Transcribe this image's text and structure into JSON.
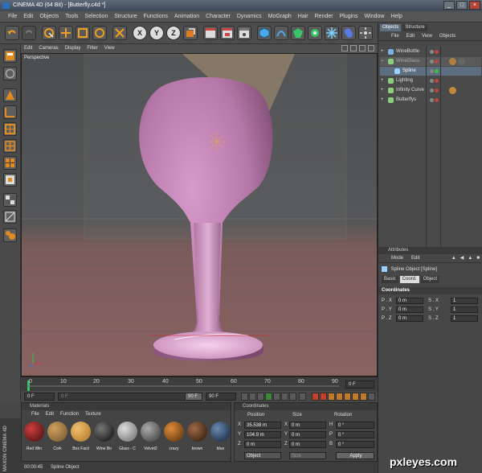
{
  "window": {
    "title": "CINEMA 4D (64 Bit) - [Butterfly.c4d *]",
    "buttons": [
      "_",
      "□",
      "×"
    ]
  },
  "menubar": [
    "File",
    "Edit",
    "Objects",
    "Tools",
    "Selection",
    "Structure",
    "Functions",
    "Animation",
    "Character",
    "Dynamics",
    "MoGraph",
    "Hair",
    "Render",
    "Plugins",
    "Window",
    "Help"
  ],
  "toolbar": {
    "axis_buttons": [
      "X",
      "Y",
      "Z"
    ]
  },
  "viewport": {
    "menu": [
      "Edit",
      "Cameras",
      "Display",
      "Filter",
      "View"
    ],
    "label": "Perspective"
  },
  "timeline": {
    "ticks": [
      "0",
      "10",
      "20",
      "30",
      "40",
      "50",
      "60",
      "70",
      "80",
      "90"
    ],
    "end_label": "0 F",
    "start_field": "0 F",
    "range_start": "0 F",
    "range_end": "90 F",
    "current": "90 F"
  },
  "materials": {
    "header": "Materials",
    "menu": [
      "File",
      "Edit",
      "Function",
      "Texture"
    ],
    "items": [
      {
        "name": "Red Win",
        "color": "#6b1a1a"
      },
      {
        "name": "Cork",
        "color": "#8a6a3a"
      },
      {
        "name": "Box Facil",
        "color": "#c08a3a"
      },
      {
        "name": "Wine Bo",
        "color": "#2a2a2a"
      },
      {
        "name": "Glass - C",
        "color": "#8a8a8a"
      },
      {
        "name": "Velvet2",
        "color": "#5a5a5a"
      },
      {
        "name": "crazy",
        "color": "#7a4a1a"
      },
      {
        "name": "brown",
        "color": "#4a2e1a"
      },
      {
        "name": "blue",
        "color": "#2a3e5a"
      }
    ]
  },
  "coordinates": {
    "header": "Coordinates",
    "columns": [
      "Position",
      "Size",
      "Rotation"
    ],
    "rows": [
      {
        "axis": "X",
        "pos": "35.538 m",
        "size_axis": "X",
        "size": "0 m",
        "rot_axis": "H",
        "rot": "0 °"
      },
      {
        "axis": "Y",
        "pos": "104.9 m",
        "size_axis": "Y",
        "size": "0 m",
        "rot_axis": "P",
        "rot": "0 °"
      },
      {
        "axis": "Z",
        "pos": "0 m",
        "size_axis": "Z",
        "size": "0 m",
        "rot_axis": "B",
        "rot": "0 °"
      }
    ],
    "mode_select": "Object",
    "size_select": "Size",
    "apply_label": "Apply"
  },
  "statusbar": {
    "time": "00:00:45",
    "message": "Spline Object"
  },
  "maxon": "MAXON CINEMA 4D",
  "objects_panel": {
    "tabs": [
      "Objects",
      "Structure"
    ],
    "menu": [
      "File",
      "Edit",
      "View",
      "Objects"
    ],
    "items": [
      {
        "name": "WineBottle",
        "indent": 0,
        "color": "#7ab0e0"
      },
      {
        "name": "WineGlass",
        "indent": 0,
        "color": "#8ccf7a"
      },
      {
        "name": "Spline",
        "indent": 1,
        "color": "#9ad0ff"
      },
      {
        "name": "Lighting",
        "indent": 0,
        "color": "#8ccf7a"
      },
      {
        "name": "Infinity Curve",
        "indent": 0,
        "color": "#8ccf7a"
      },
      {
        "name": "Butterflys",
        "indent": 0,
        "color": "#8ccf7a"
      }
    ]
  },
  "attributes": {
    "header": "Attributes",
    "menu": [
      "Mode",
      "Edit"
    ],
    "title": "Spline Object [Spline]",
    "tabs": [
      "Basic",
      "Coord.",
      "Object"
    ],
    "section": "Coordinates",
    "rows": [
      {
        "a": "P . X",
        "av": "0 m",
        "b": "S . X",
        "bv": "1"
      },
      {
        "a": "P . Y",
        "av": "0 m",
        "b": "S . Y",
        "bv": "1"
      },
      {
        "a": "P . Z",
        "av": "0 m",
        "b": "S . Z",
        "bv": "1"
      }
    ]
  },
  "watermark": "pxleyes.com"
}
